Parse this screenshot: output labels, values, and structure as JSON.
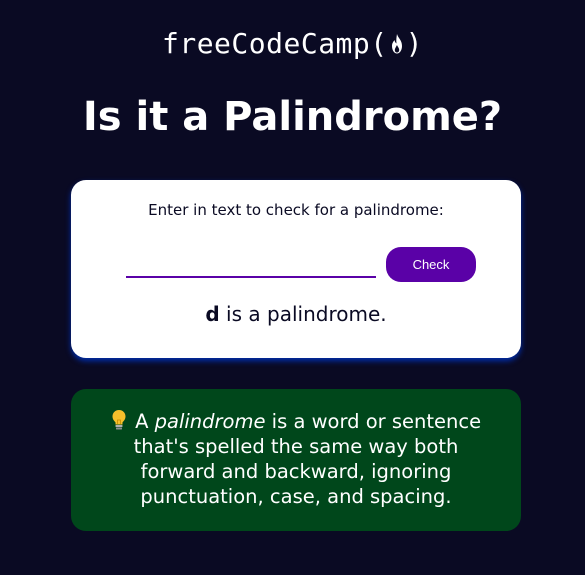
{
  "header": {
    "logo_text_before": "freeCodeCamp(",
    "logo_text_after": ")",
    "logo_icon": "flame-icon",
    "title": "Is it a Palindrome?"
  },
  "card": {
    "label": "Enter in text to check for a palindrome:",
    "input_value": "",
    "button_label": "Check",
    "result_word": "d",
    "result_suffix": " is a palindrome."
  },
  "info": {
    "icon": "lightbulb-icon",
    "before": " A ",
    "emphasis": "palindrome",
    "after": " is a word or sentence that's spelled the same way both forward and backward, ignoring punctuation, case, and spacing."
  },
  "colors": {
    "background": "#0a0a23",
    "card_background": "#ffffff",
    "accent": "#5a01a7",
    "card_shadow": "#002ead",
    "info_background": "#00471b",
    "text_light": "#ffffff",
    "text_dark": "#0a0a23",
    "bulb": "#f5c02b"
  }
}
